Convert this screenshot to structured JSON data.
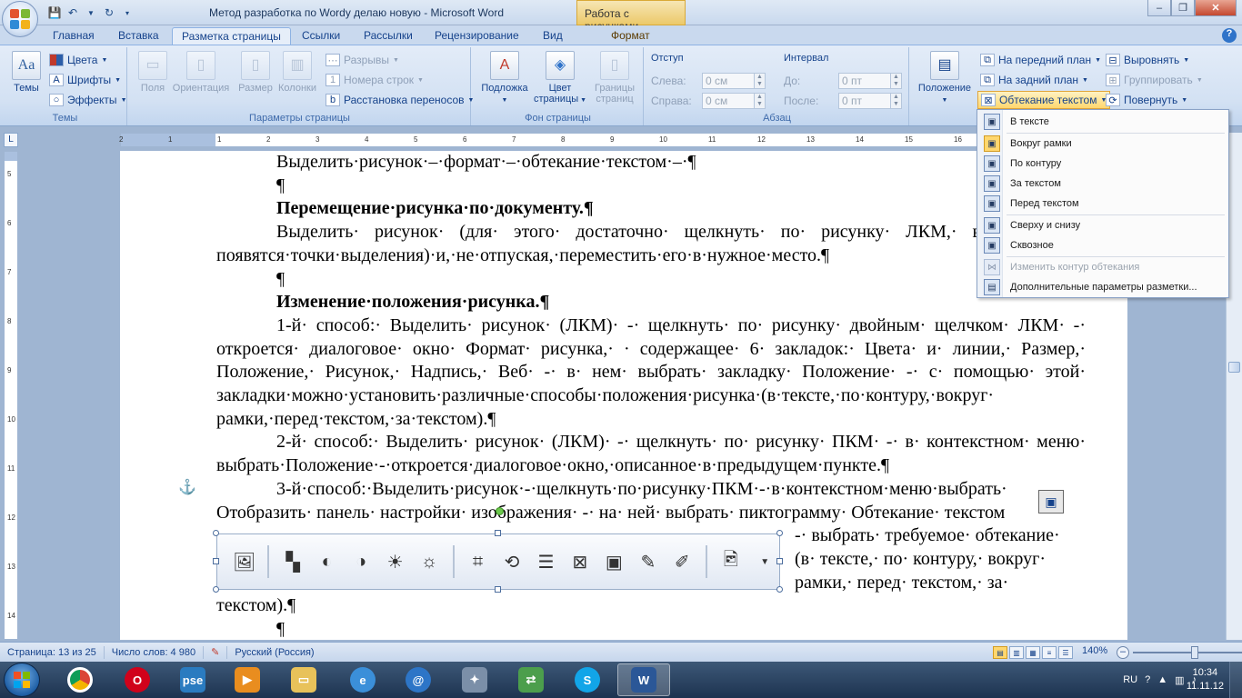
{
  "window": {
    "title": "Метод разработка по Wordy делаю новую - Microsoft Word",
    "context_tab_header": "Работа с рисунками"
  },
  "tabs": [
    {
      "label": "Главная"
    },
    {
      "label": "Вставка"
    },
    {
      "label": "Разметка страницы",
      "active": true
    },
    {
      "label": "Ссылки"
    },
    {
      "label": "Рассылки"
    },
    {
      "label": "Рецензирование"
    },
    {
      "label": "Вид"
    },
    {
      "label": "Формат",
      "contextual": true
    }
  ],
  "ribbon": {
    "themes": {
      "label": "Темы",
      "button": "Темы",
      "colors": "Цвета",
      "fonts": "Шрифты",
      "effects": "Эффекты"
    },
    "page_setup": {
      "label": "Параметры страницы",
      "margins": "Поля",
      "orientation": "Ориентация",
      "size": "Размер",
      "columns": "Колонки",
      "breaks": "Разрывы",
      "line_numbers": "Номера строк",
      "hyphenation": "Расстановка переносов"
    },
    "page_background": {
      "label": "Фон страницы",
      "watermark": "Подложка",
      "page_color_1": "Цвет",
      "page_color_2": "страницы",
      "page_borders_1": "Границы",
      "page_borders_2": "страниц"
    },
    "paragraph": {
      "label": "Абзац",
      "indent_title": "Отступ",
      "left_label": "Слева:",
      "left_value": "0 см",
      "right_label": "Справа:",
      "right_value": "0 см",
      "spacing_title": "Интервал",
      "before_label": "До:",
      "before_value": "0 пт",
      "after_label": "После:",
      "after_value": "0 пт"
    },
    "arrange": {
      "position": "Положение",
      "bring_front": "На передний план",
      "send_back": "На задний план",
      "text_wrapping": "Обтекание текстом",
      "align": "Выровнять",
      "group": "Группировать",
      "rotate": "Повернуть"
    }
  },
  "wrap_menu": {
    "items": [
      {
        "label": "В тексте"
      },
      {
        "label": "Вокруг рамки",
        "checked": true
      },
      {
        "label": "По контуру"
      },
      {
        "label": "За текстом"
      },
      {
        "label": "Перед текстом"
      },
      {
        "label": "Сверху и снизу"
      },
      {
        "label": "Сквозное"
      },
      {
        "label": "Изменить контур обтекания",
        "disabled": true
      },
      {
        "label": "Дополнительные параметры разметки..."
      }
    ]
  },
  "document": {
    "p1": "Выделить·рисунок·–·формат·–·обтекание·текстом·–·¶",
    "p2": "¶",
    "p3": "Перемещение·рисунка·по·документу.¶",
    "p4": "Выделить· рисунок· (для· этого· достаточно· щелкнуть· по· рисунку· ЛКМ,· вокруг· него· появятся·точки·выделения)·и,·не·отпуская,·переместить·его·в·нужное·место.¶",
    "p5": "¶",
    "p6": "Изменение·положения·рисунка.¶",
    "p7": "1-й· способ:· Выделить· рисунок· (ЛКМ)· -· щелкнуть· по· рисунку· двойным· щелчком· ЛКМ· -· откроется· диалоговое· окно· Формат· рисунка,· · содержащее· 6· закладок:· Цвета· и· линии,· Размер,· Положение,· Рисунок,· Надпись,· Веб· -· в· нем· выбрать· закладку· Положение· -· с· помощью· этой· закладки·можно·установить·различные·способы·положения·рисунка·(в·тексте,·по·контуру,·вокруг· рамки,·перед·текстом,·за·текстом).¶",
    "p8": "2-й· способ:· Выделить· рисунок· (ЛКМ)· -· щелкнуть· по· рисунку· ПКМ· -· в· контекстном· меню· выбрать·Положение·-·откроется·диалоговое·окно,·описанное·в·предыдущем·пункте.¶",
    "p9_line1": "3-й·способ:·Выделить·рисунок·-·щелкнуть·по·рисунку·ПКМ·-·в·контекстном·меню·выбрать·",
    "p9_line2": "Отобразить· панель· настройки· изображения· -· на· ней· выбрать· пиктограмму· Обтекание· текстом",
    "p9_right_1": "-· выбрать· требуемое· обтекание·",
    "p9_right_2": "(в· тексте,· по· контуру,· вокруг·",
    "p9_right_3": "рамки,· перед· текстом,· за·",
    "p9_end": "текстом).¶",
    "p10": "¶"
  },
  "statusbar": {
    "page": "Страница: 13 из 25",
    "words": "Число слов: 4 980",
    "language": "Русский (Россия)",
    "zoom": "140%"
  },
  "taskbar": {
    "apps": [
      {
        "name": "chrome"
      },
      {
        "name": "opera"
      },
      {
        "name": "pse",
        "label": "pse"
      },
      {
        "name": "media"
      },
      {
        "name": "explorer"
      },
      {
        "name": "ie"
      },
      {
        "name": "mail"
      },
      {
        "name": "tools"
      },
      {
        "name": "network"
      },
      {
        "name": "skype"
      },
      {
        "name": "word"
      }
    ],
    "lang": "RU",
    "time": "10:34",
    "date": "11.11.12"
  }
}
